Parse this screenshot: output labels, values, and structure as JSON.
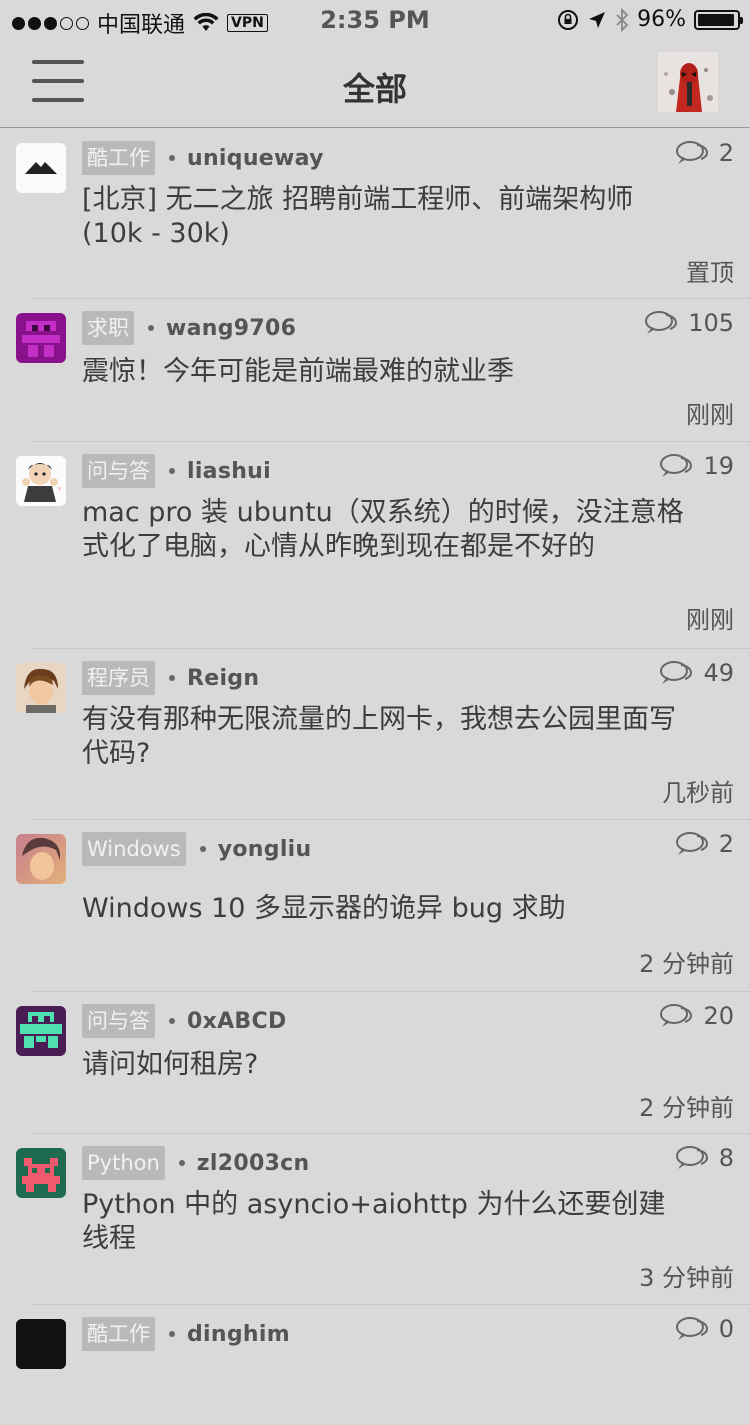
{
  "status_bar": {
    "carrier": "中国联通",
    "vpn": "VPN",
    "time": "2:35 PM",
    "battery": "96%",
    "battery_level": 0.96
  },
  "nav": {
    "title": "全部"
  },
  "topics": [
    {
      "tag": "酷工作",
      "author": "uniqueway",
      "replies": "2",
      "title": "[北京] 无二之旅 招聘前端工程师、前端架构师 (10k - 30k)",
      "time": "置顶"
    },
    {
      "tag": "求职",
      "author": "wang9706",
      "replies": "105",
      "title": "震惊！今年可能是前端最难的就业季",
      "time": "刚刚"
    },
    {
      "tag": "问与答",
      "author": "liashui",
      "replies": "19",
      "title": "mac pro 装 ubuntu（双系统）的时候，没注意格式化了电脑，心情从昨晚到现在都是不好的",
      "time": "刚刚"
    },
    {
      "tag": "程序员",
      "author": "Reign",
      "replies": "49",
      "title": "有没有那种无限流量的上网卡，我想去公园里面写代码?",
      "time": "几秒前"
    },
    {
      "tag": "Windows",
      "author": "yongliu",
      "replies": "2",
      "title": "Windows 10 多显示器的诡异 bug 求助",
      "time": "2 分钟前"
    },
    {
      "tag": "问与答",
      "author": "0xABCD",
      "replies": "20",
      "title": "请问如何租房?",
      "time": "2 分钟前"
    },
    {
      "tag": "Python",
      "author": "zl2003cn",
      "replies": "8",
      "title": "Python 中的 asyncio+aiohttp 为什么还要创建线程",
      "time": "3 分钟前"
    },
    {
      "tag": "酷工作",
      "author": "dinghim",
      "replies": "0",
      "title": "",
      "time": ""
    }
  ]
}
